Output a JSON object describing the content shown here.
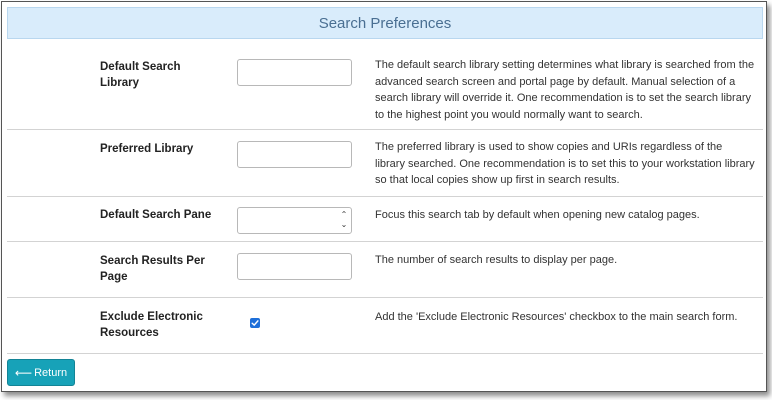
{
  "header": {
    "title": "Search Preferences"
  },
  "rows": [
    {
      "label": "Default Search Library",
      "description": "The default search library setting determines what library is searched from the advanced search screen and portal page by default. Manual selection of a search library will override it. One recommendation is to set the search library to the highest point you would normally want to search.",
      "control": "text",
      "value": ""
    },
    {
      "label": "Preferred Library",
      "description": "The preferred library is used to show copies and URIs regardless of the library searched. One recommendation is to set this to your workstation library so that local copies show up first in search results.",
      "control": "text",
      "value": ""
    },
    {
      "label": "Default Search Pane",
      "description": "Focus this search tab by default when opening new catalog pages.",
      "control": "select",
      "value": ""
    },
    {
      "label": "Search Results Per Page",
      "description": "The number of search results to display per page.",
      "control": "number",
      "value": ""
    },
    {
      "label": "Exclude Electronic Resources",
      "description": "Add the 'Exclude Electronic Resources' checkbox to the main search form.",
      "control": "checkbox",
      "checked": true
    }
  ],
  "footer": {
    "return_label": "Return",
    "return_icon": "arrow-left-icon"
  },
  "colors": {
    "header_bg": "#d9ecfb",
    "header_text": "#4a6f92",
    "button_bg": "#17a2b8",
    "checkbox": "#1e6fd9"
  }
}
